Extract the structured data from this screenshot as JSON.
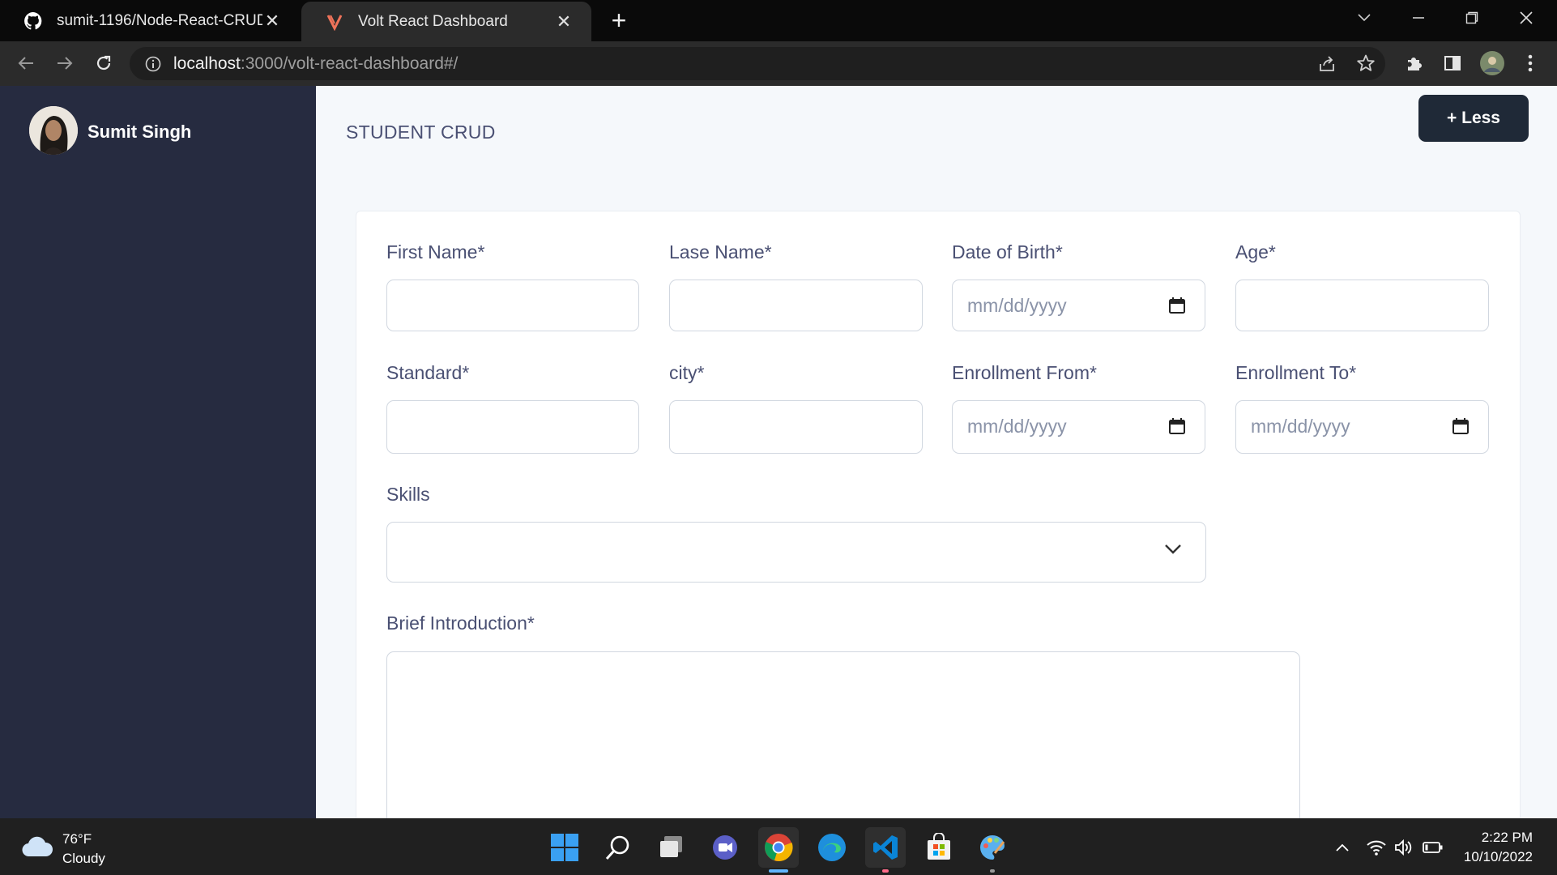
{
  "browser": {
    "tabs": [
      {
        "title": "sumit-1196/Node-React-CRUD",
        "icon": "github-icon",
        "active": false
      },
      {
        "title": "Volt React Dashboard",
        "icon": "volt-icon",
        "active": true
      }
    ],
    "url_host": "localhost",
    "url_rest": ":3000/volt-react-dashboard#/"
  },
  "sidebar": {
    "user_name": "Sumit Singh"
  },
  "header": {
    "title": "STUDENT CRUD",
    "toggle_button": "+ Less"
  },
  "form": {
    "first_name": {
      "label": "First Name*"
    },
    "last_name": {
      "label": "Lase Name*"
    },
    "dob": {
      "label": "Date of Birth*",
      "placeholder": "mm/dd/yyyy"
    },
    "age": {
      "label": "Age*"
    },
    "standard": {
      "label": "Standard*"
    },
    "city": {
      "label": "city*"
    },
    "enroll_from": {
      "label": "Enrollment From*",
      "placeholder": "mm/dd/yyyy"
    },
    "enroll_to": {
      "label": "Enrollment To*",
      "placeholder": "mm/dd/yyyy"
    },
    "skills": {
      "label": "Skills",
      "value": ""
    },
    "intro": {
      "label": "Brief Introduction*"
    }
  },
  "taskbar": {
    "weather_temp": "76°F",
    "weather_desc": "Cloudy",
    "time": "2:22 PM",
    "date": "10/10/2022"
  },
  "colors": {
    "sidebar_bg": "#262b40",
    "main_bg": "#f5f8fb",
    "button_bg": "#1f2937",
    "label_text": "#4a5073"
  }
}
